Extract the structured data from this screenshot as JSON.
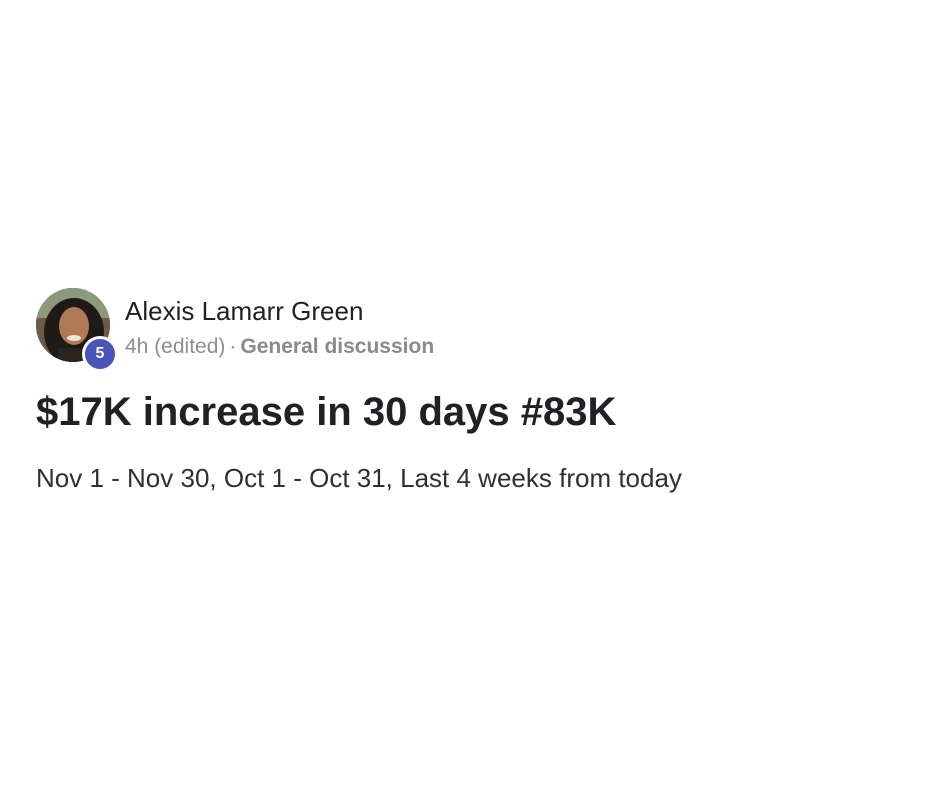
{
  "post": {
    "author": {
      "name": "Alexis Lamarr Green",
      "level": "5"
    },
    "time": "4h (edited)",
    "separator": "·",
    "category": "General discussion",
    "title": "$17K increase in 30 days #83K",
    "body": "Nov 1 - Nov 30, Oct 1 - Oct 31, Last 4 weeks from today"
  },
  "colors": {
    "level_badge": "#4a53b8",
    "text_primary": "#202124",
    "text_muted": "#8e8e8e"
  }
}
